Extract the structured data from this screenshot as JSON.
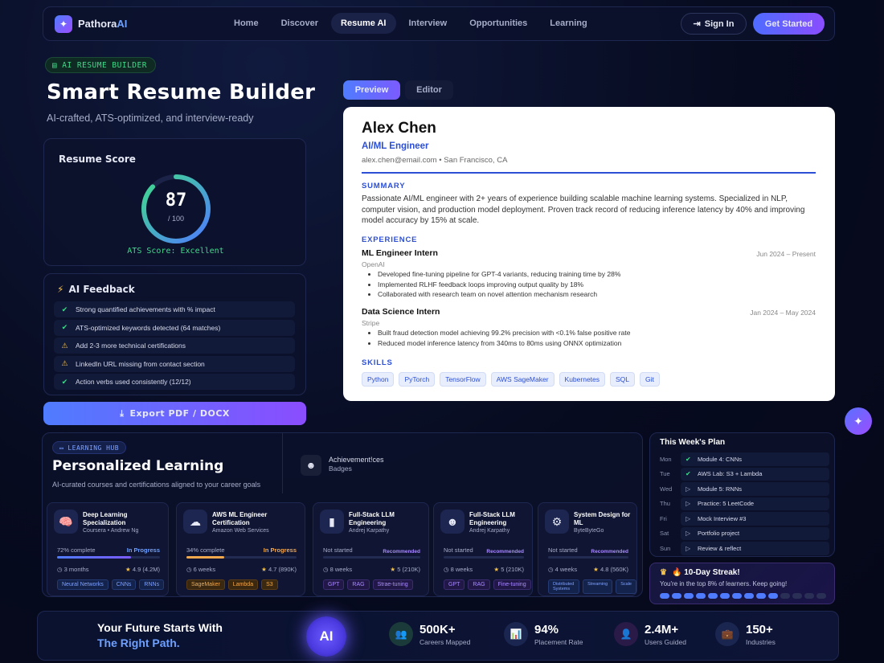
{
  "nav": {
    "brand": "Pathora",
    "brand_ai": "AI",
    "links": [
      "Home",
      "Discover",
      "Resume AI",
      "Interview",
      "Opportunities",
      "Learning"
    ],
    "active": "Resume AI",
    "signin": "Sign In",
    "get_started": "Get Started"
  },
  "hero": {
    "badge": "AI RESUME BUILDER",
    "title": "Smart Resume Builder",
    "subtitle": "AI-crafted, ATS-optimized, and interview-ready"
  },
  "score": {
    "title": "Resume Score",
    "value": "87",
    "max": "/ 100",
    "fraction": 0.87,
    "ats": "ATS Score: Excellent"
  },
  "feedback": {
    "title": "AI Feedback",
    "items": [
      {
        "text": "Strong quantified achievements with % impact",
        "status": "ok"
      },
      {
        "text": "ATS-optimized keywords detected (64 matches)",
        "status": "ok"
      },
      {
        "text": "Add 2-3 more technical certifications",
        "status": "warn"
      },
      {
        "text": "LinkedIn URL missing from contact section",
        "status": "warn"
      },
      {
        "text": "Action verbs used consistently (12/12)",
        "status": "ok"
      }
    ]
  },
  "export_label": "Export PDF / DOCX",
  "tabs": {
    "preview": "Preview",
    "editor": "Editor"
  },
  "resume": {
    "name": "Alex Chen",
    "role": "AI/ML Engineer",
    "contact": "alex.chen@email.com • San Francisco, CA",
    "summary_h": "SUMMARY",
    "summary": "Passionate AI/ML engineer with 2+ years of experience building scalable machine learning systems. Specialized in NLP, computer vision, and production model deployment. Proven track record of reducing inference latency by 40% and improving model accuracy by 15% at scale.",
    "experience_h": "EXPERIENCE",
    "jobs": [
      {
        "title": "ML Engineer Intern",
        "company": "OpenAI",
        "date": "Jun 2024 – Present",
        "bullets": [
          "Developed fine-tuning pipeline for GPT-4 variants, reducing training time by 28%",
          "Implemented RLHF feedback loops improving output quality by 18%",
          "Collaborated with research team on novel attention mechanism research"
        ]
      },
      {
        "title": "Data Science Intern",
        "company": "Stripe",
        "date": "Jan 2024 – May 2024",
        "bullets": [
          "Built fraud detection model achieving 99.2% precision with <0.1% false positive rate",
          "Reduced model inference latency from 340ms to 80ms using ONNX optimization"
        ]
      }
    ],
    "skills_h": "SKILLS",
    "skills": [
      "Python",
      "PyTorch",
      "TensorFlow",
      "AWS SageMaker",
      "Kubernetes",
      "SQL",
      "Git"
    ]
  },
  "learning": {
    "badge": "LEARNING HUB",
    "title": "Personalized Learning",
    "subtitle": "AI-curated courses and certifications aligned to your career goals",
    "achievement_title": "Achievement!ces",
    "achievement_sub": "Badges",
    "courses": [
      {
        "title": "Deep Learning Specialization",
        "org": "Coursera • Andrew Ng",
        "status": "72% complete",
        "status2": "In Progress",
        "progress": 0.72,
        "duration": "3 months",
        "rating": "4.9 (4.2M)",
        "tags": [
          "Neural Networks",
          "CNNs",
          "RNNs"
        ],
        "icon": "brain-icon",
        "glyph": "🧠"
      },
      {
        "title": "AWS ML Engineer Certification",
        "org": "Amazon Web Services",
        "status": "34% complete",
        "status2": "In Progress",
        "progress": 0.34,
        "duration": "6 weeks",
        "rating": "4.7 (890K)",
        "tags": [
          "SageMaker",
          "Lambda",
          "S3"
        ],
        "icon": "cloud-icon",
        "glyph": "☁"
      },
      {
        "title": "Full-Stack LLM Engineering",
        "org": "Andrej Karpathy",
        "status": "Not started",
        "status2": "Recommended",
        "progress": 0,
        "duration": "8 weeks",
        "rating": "5 (210K)",
        "tags": [
          "GPT",
          "RAG",
          "Strae-tuning"
        ],
        "icon": "chart-icon",
        "glyph": "▮"
      },
      {
        "title": "Full-Stack LLM Engineering",
        "org": "Andrej Karpathy",
        "status": "Not started",
        "status2": "Recommended",
        "progress": 0,
        "duration": "8 weeks",
        "rating": "5 (210K)",
        "tags": [
          "GPT",
          "RAG",
          "Fine-tuning"
        ],
        "icon": "robot-icon",
        "glyph": "☻"
      },
      {
        "title": "System Design for ML",
        "org": "ByteByteGo",
        "status": "Not started",
        "status2": "Recommended",
        "progress": 0,
        "duration": "4 weeks",
        "rating": "4.8 (560K)",
        "tags": [
          "Distributed Systems",
          "Streaming",
          "Scale"
        ],
        "icon": "gear-icon",
        "glyph": "⚙"
      }
    ]
  },
  "plan": {
    "title": "This Week's Plan",
    "days": [
      {
        "day": "Mon",
        "task": "Module 4: CNNs",
        "done": true
      },
      {
        "day": "Tue",
        "task": "AWS Lab: S3 + Lambda",
        "done": true
      },
      {
        "day": "Wed",
        "task": "Module 5: RNNs",
        "done": false
      },
      {
        "day": "Thu",
        "task": "Practice: 5 LeetCode",
        "done": false
      },
      {
        "day": "Fri",
        "task": "Mock Interview #3",
        "done": false
      },
      {
        "day": "Sat",
        "task": "Portfolio project",
        "done": false
      },
      {
        "day": "Sun",
        "task": "Review & reflect",
        "done": false
      }
    ]
  },
  "streak": {
    "title": "🔥 10-Day Streak!",
    "subtitle": "You're in the top 8% of learners. Keep going!",
    "filled": 10,
    "total": 14
  },
  "footer": {
    "line1": "Your Future Starts With",
    "line2": "The Right Path.",
    "orb": "AI",
    "stats": [
      {
        "num": "500K+",
        "label": "Careers Mapped",
        "icon": "users-icon",
        "glyph": "👥",
        "color": "#1b3a3a"
      },
      {
        "num": "94%",
        "label": "Placement Rate",
        "icon": "bar-chart-icon",
        "glyph": "📊",
        "color": "#1a2650"
      },
      {
        "num": "2.4M+",
        "label": "Users Guided",
        "icon": "user-group-icon",
        "glyph": "👤",
        "color": "#2a1a48"
      },
      {
        "num": "150+",
        "label": "Industries",
        "icon": "briefcase-icon",
        "glyph": "💼",
        "color": "#1a2650"
      }
    ]
  }
}
